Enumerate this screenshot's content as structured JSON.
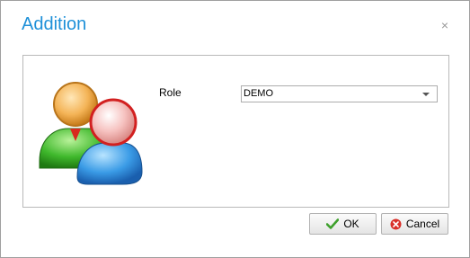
{
  "dialog": {
    "title": "Addition",
    "close_glyph": "×"
  },
  "form": {
    "role_label": "Role",
    "role_value": "DEMO",
    "illustration_icon": "users-icon"
  },
  "buttons": {
    "ok_label": "OK",
    "ok_icon": "checkmark-icon",
    "cancel_label": "Cancel",
    "cancel_icon": "cancel-circle-icon"
  },
  "colors": {
    "title": "#1e90d8",
    "ok_check": "#3ea02c",
    "cancel_icon": "#d9302a"
  }
}
